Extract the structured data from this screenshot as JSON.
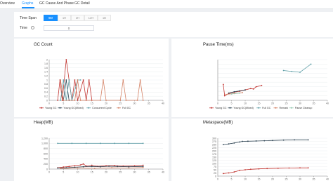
{
  "tabs": [
    {
      "label": "Overview",
      "active": false
    },
    {
      "label": "Graphs",
      "active": true
    },
    {
      "label": "GC Cause And Phase",
      "active": false
    },
    {
      "label": "GC Detail",
      "active": false
    }
  ],
  "controls": {
    "time_span_label": "Time Span",
    "time_span_options": [
      "6M",
      "1H",
      "2H",
      "12H",
      "1D"
    ],
    "time_label": "Time",
    "time_value": "0"
  },
  "chart_data": [
    {
      "type": "line",
      "title": "GC Count",
      "xlim": [
        0,
        40
      ],
      "ylim": [
        0,
        2
      ],
      "x_ticks": [
        0,
        5,
        10,
        15,
        20,
        25,
        30,
        35,
        40
      ],
      "y_ticks": [
        0,
        0.2,
        0.4,
        0.6,
        0.8,
        1,
        1.2,
        1.4,
        1.6,
        1.8,
        2
      ],
      "y_tick_labels": [
        "0",
        "0.2",
        "0.4",
        "0.6",
        "0.8",
        "1",
        "1.2",
        "1.4",
        "1.6",
        "1.8",
        "2"
      ],
      "series": [
        {
          "name": "Young GC",
          "color": "#c23531",
          "points": [
            [
              3,
              0
            ],
            [
              3.8,
              1
            ],
            [
              4.6,
              0
            ],
            [
              6,
              2
            ],
            [
              7,
              1
            ],
            [
              8,
              0
            ],
            [
              9,
              1
            ],
            [
              10,
              0
            ],
            [
              12,
              1
            ],
            [
              13,
              0
            ],
            [
              14,
              1
            ],
            [
              15,
              0
            ]
          ]
        },
        {
          "name": "Young GC(Mixed)",
          "color": "#2f4554",
          "points": [
            [
              5,
              0
            ],
            [
              6,
              1
            ],
            [
              7,
              0
            ]
          ]
        },
        {
          "name": "Concurrent Cycle",
          "color": "#61a0a8",
          "points": [
            [
              4,
              0
            ],
            [
              5,
              1
            ],
            [
              6,
              0
            ],
            [
              7,
              1
            ],
            [
              8,
              0
            ],
            [
              10,
              1
            ],
            [
              11,
              1
            ]
          ]
        },
        {
          "name": "Full GC",
          "color": "#d48265",
          "points": [
            [
              4,
              1
            ],
            [
              5,
              0
            ],
            [
              9,
              0
            ],
            [
              10,
              1
            ],
            [
              11,
              0
            ],
            [
              18,
              0
            ],
            [
              19,
              1
            ],
            [
              20,
              0
            ],
            [
              25,
              0
            ],
            [
              26,
              1
            ],
            [
              27,
              0
            ],
            [
              31,
              0
            ],
            [
              32,
              1
            ],
            [
              33,
              0
            ]
          ]
        }
      ]
    },
    {
      "type": "line",
      "title": "Pause Time(ms)",
      "xlim": [
        0,
        40
      ],
      "x_ticks": [
        0,
        5,
        10,
        15,
        20,
        25,
        30,
        35,
        40
      ],
      "y_ticks": [
        0,
        1,
        2,
        3,
        4,
        5,
        6,
        7,
        8,
        9
      ],
      "y_tick_labels": [
        "",
        "",
        "",
        "",
        "",
        "",
        "",
        "",
        "",
        ""
      ],
      "series": [
        {
          "name": "Young GC",
          "color": "#c23531",
          "points": [
            [
              2,
              3.5
            ],
            [
              2.5,
              1
            ],
            [
              4,
              1.5
            ],
            [
              6,
              1.8
            ],
            [
              8,
              2
            ],
            [
              10,
              2.3
            ],
            [
              12,
              2.6
            ],
            [
              13,
              2.5
            ],
            [
              14,
              3
            ],
            [
              16,
              3.3
            ]
          ]
        },
        {
          "name": "Young GC(Mixed)",
          "color": "#2f4554",
          "points": [
            [
              4,
              1.6
            ],
            [
              6,
              1.9
            ],
            [
              8,
              2.1
            ],
            [
              10,
              2.3
            ]
          ]
        },
        {
          "name": "Full GC",
          "color": "#61a0a8",
          "points": [
            [
              24,
              6.6
            ],
            [
              27,
              6.4
            ],
            [
              30,
              6.2
            ],
            [
              34,
              8
            ]
          ]
        },
        {
          "name": "Remark",
          "color": "#d48265",
          "points": [
            [
              3,
              1.3
            ],
            [
              6,
              1.5
            ],
            [
              9,
              1.7
            ]
          ]
        },
        {
          "name": "Pause Cleanup",
          "color": "#91c7ae",
          "points": [
            [
              5,
              1.4
            ],
            [
              8,
              1.6
            ]
          ]
        }
      ]
    },
    {
      "type": "line",
      "title": "Heap(MB)",
      "xlim": [
        0,
        40
      ],
      "ylim": [
        0,
        1200
      ],
      "x_ticks": [
        0,
        5,
        10,
        15,
        20,
        25,
        30,
        35,
        40
      ],
      "y_ticks": [
        0,
        200,
        400,
        600,
        800,
        1000,
        1200
      ],
      "y_tick_labels": [
        "0",
        "200",
        "400",
        "600",
        "800",
        "1,000",
        "1,200"
      ],
      "series": [
        {
          "name": "Young",
          "color": "#c23531",
          "points": [
            [
              3,
              50
            ],
            [
              5,
              80
            ],
            [
              7,
              100
            ],
            [
              9,
              130
            ],
            [
              11,
              160
            ],
            [
              12,
              200
            ],
            [
              13,
              120
            ],
            [
              15,
              150
            ],
            [
              17,
              110
            ],
            [
              20,
              130
            ],
            [
              23,
              140
            ],
            [
              26,
              120
            ],
            [
              30,
              130
            ],
            [
              33,
              150
            ]
          ]
        },
        {
          "name": "Old",
          "color": "#2f4554",
          "points": [
            [
              3,
              40
            ],
            [
              6,
              50
            ],
            [
              9,
              70
            ],
            [
              12,
              90
            ],
            [
              15,
              100
            ],
            [
              18,
              90
            ],
            [
              21,
              110
            ],
            [
              24,
              100
            ],
            [
              28,
              90
            ],
            [
              33,
              100
            ]
          ]
        },
        {
          "name": "Heap",
          "color": "#61a0a8",
          "points": [
            [
              3,
              1000
            ],
            [
              8,
              1000
            ],
            [
              13,
              1000
            ],
            [
              18,
              1000
            ],
            [
              23,
              1000
            ],
            [
              28,
              1000
            ],
            [
              33,
              1000
            ]
          ]
        },
        {
          "name": "Humongous",
          "color": "#d48265",
          "points": [
            [
              4,
              20
            ],
            [
              10,
              40
            ],
            [
              16,
              30
            ],
            [
              22,
              50
            ],
            [
              28,
              40
            ],
            [
              33,
              60
            ]
          ]
        }
      ]
    },
    {
      "type": "line",
      "title": "Metaspace(MB)",
      "xlim": [
        0,
        40
      ],
      "ylim": [
        0,
        300
      ],
      "x_ticks": [
        0,
        5,
        10,
        15,
        20,
        25,
        30,
        35,
        40
      ],
      "y_ticks": [
        0,
        25,
        50,
        75,
        100,
        125,
        150,
        175,
        200,
        225,
        250,
        275,
        300
      ],
      "y_tick_labels": [
        "0",
        "25",
        "50",
        "75",
        "100",
        "125",
        "150",
        "175",
        "200",
        "225",
        "250",
        "275",
        "300"
      ],
      "series": [
        {
          "name": "Metaspace",
          "color": "#2f4554",
          "points": [
            [
              2,
              250
            ],
            [
              4,
              255
            ],
            [
              6,
              262
            ],
            [
              8,
              270
            ],
            [
              9,
              275
            ],
            [
              11,
              276
            ],
            [
              14,
              278
            ],
            [
              17,
              280
            ],
            [
              20,
              282
            ],
            [
              24,
              285
            ],
            [
              28,
              287
            ],
            [
              33,
              287
            ]
          ]
        },
        {
          "name": "Class Space",
          "color": "#c23531",
          "points": [
            [
              2,
              20
            ],
            [
              4,
              25
            ],
            [
              6,
              33
            ],
            [
              8,
              45
            ],
            [
              10,
              50
            ],
            [
              12,
              54
            ],
            [
              15,
              57
            ],
            [
              18,
              60
            ],
            [
              22,
              62
            ],
            [
              26,
              64
            ],
            [
              30,
              65
            ],
            [
              33,
              65
            ]
          ]
        }
      ]
    }
  ]
}
